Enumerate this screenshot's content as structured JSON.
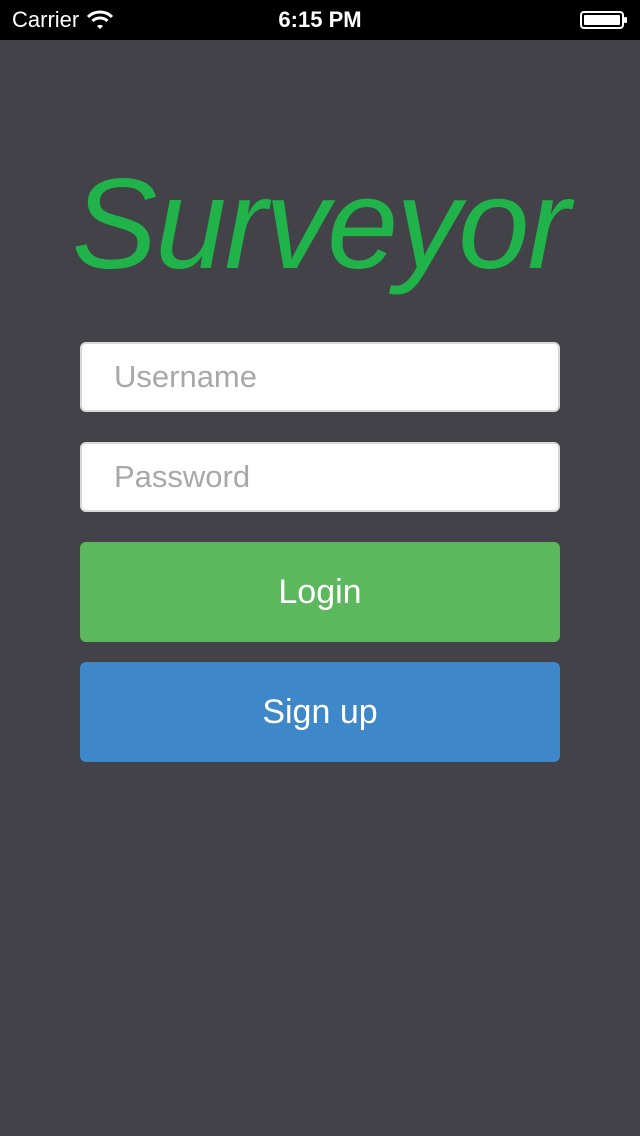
{
  "status_bar": {
    "carrier": "Carrier",
    "time": "6:15 PM",
    "wifi_icon": "wifi-icon",
    "battery_icon": "battery-icon"
  },
  "app": {
    "title": "Surveyor",
    "title_color": "#1fb34a",
    "background_color": "#424248"
  },
  "form": {
    "username_placeholder": "Username",
    "username_value": "",
    "password_placeholder": "Password",
    "password_value": "",
    "login_label": "Login",
    "login_color": "#5cb85c",
    "signup_label": "Sign up",
    "signup_color": "#3e88ca"
  }
}
